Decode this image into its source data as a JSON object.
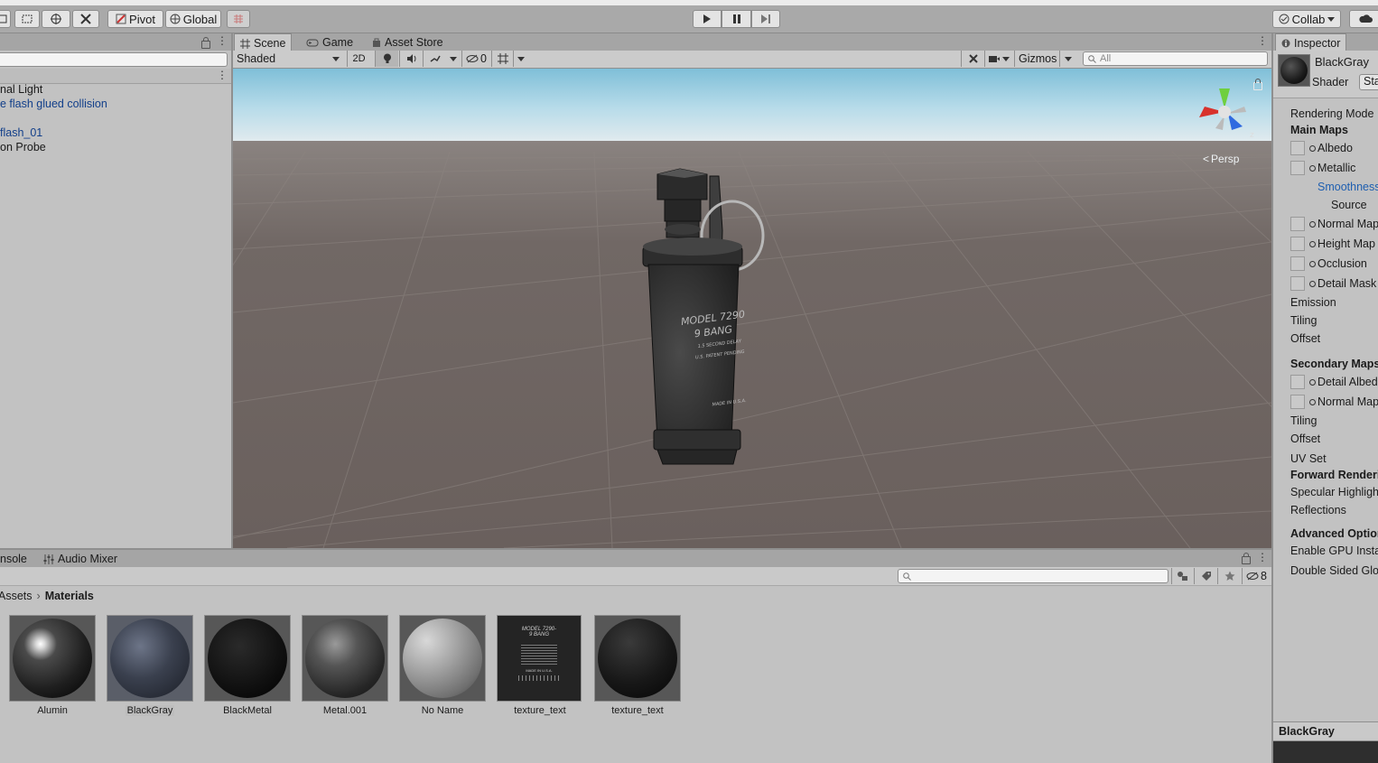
{
  "toolbar": {
    "pivot_label": "Pivot",
    "global_label": "Global",
    "collab_label": "Collab"
  },
  "hierarchy": {
    "items": [
      {
        "label": "nal Light",
        "color": "#1a1a1a"
      },
      {
        "label": "e flash glued collision",
        "color": "#123f8a"
      },
      {
        "label": "flash_01",
        "color": "#123f8a"
      },
      {
        "label": "on Probe",
        "color": "#1a1a1a"
      }
    ]
  },
  "scene": {
    "tabs": [
      {
        "label": "Scene",
        "icon": "grid-icon"
      },
      {
        "label": "Game",
        "icon": "gamepad-icon"
      },
      {
        "label": "Asset Store",
        "icon": "store-icon"
      }
    ],
    "shading_mode": "Shaded",
    "mode_2d": "2D",
    "hidden_count": "0",
    "gizmos_label": "Gizmos",
    "search_placeholder": "All",
    "persp_label": "Persp",
    "grenade_text": {
      "model_line": "MODEL 7290",
      "bang_line": "9 BANG",
      "delay_line": "1.5 SECOND DELAY",
      "patent_line": "U.S. PATENT PENDING",
      "made_line": "MADE IN U.S.A."
    }
  },
  "project": {
    "tabs": [
      {
        "label": "nsole"
      },
      {
        "label": "Audio Mixer",
        "icon": "mixer-icon"
      }
    ],
    "breadcrumb": {
      "root": "Assets",
      "current": "Materials"
    },
    "hidden_count": "8",
    "assets": [
      {
        "name": "Alumin",
        "selected": false
      },
      {
        "name": "BlackGray",
        "selected": true
      },
      {
        "name": "BlackMetal",
        "selected": false
      },
      {
        "name": "Metal.001",
        "selected": false
      },
      {
        "name": "No Name",
        "selected": false
      },
      {
        "name": "texture_text",
        "selected": false
      },
      {
        "name": "texture_text",
        "selected": false
      }
    ],
    "texture_thumb": {
      "line1": "MODEL 7290-",
      "line2": "9 BANG",
      "line3": "MADE IN U.S.A."
    }
  },
  "inspector": {
    "tab_label": "Inspector",
    "material_name": "BlackGray",
    "shader_label": "Shader",
    "shader_value": "Sta",
    "rows": {
      "rendering_mode": "Rendering Mode",
      "main_maps": "Main Maps",
      "albedo": "Albedo",
      "metallic": "Metallic",
      "smoothness": "Smoothness",
      "source": "Source",
      "normal_map": "Normal Map",
      "height_map": "Height Map",
      "occlusion": "Occlusion",
      "detail_mask": "Detail Mask",
      "emission": "Emission",
      "tiling": "Tiling",
      "offset": "Offset",
      "secondary_maps": "Secondary Maps",
      "detail_albedo": "Detail Albed",
      "normal_map2": "Normal Map",
      "tiling2": "Tiling",
      "offset2": "Offset",
      "uv_set": "UV Set",
      "forward_rendering": "Forward Renderi",
      "specular_highlights": "Specular Highligh",
      "reflections": "Reflections",
      "advanced_options": "Advanced Option",
      "gpu_instancing": "Enable GPU Insta",
      "double_sided": "Double Sided Glo"
    },
    "preview_label": "BlackGray"
  },
  "colors": {
    "toolbar_bg": "#a9a9a9",
    "panel_bg": "#c2c2c2",
    "link_blue": "#123f8a",
    "sky_top": "#b6dbe9",
    "ground": "#6c6360"
  }
}
